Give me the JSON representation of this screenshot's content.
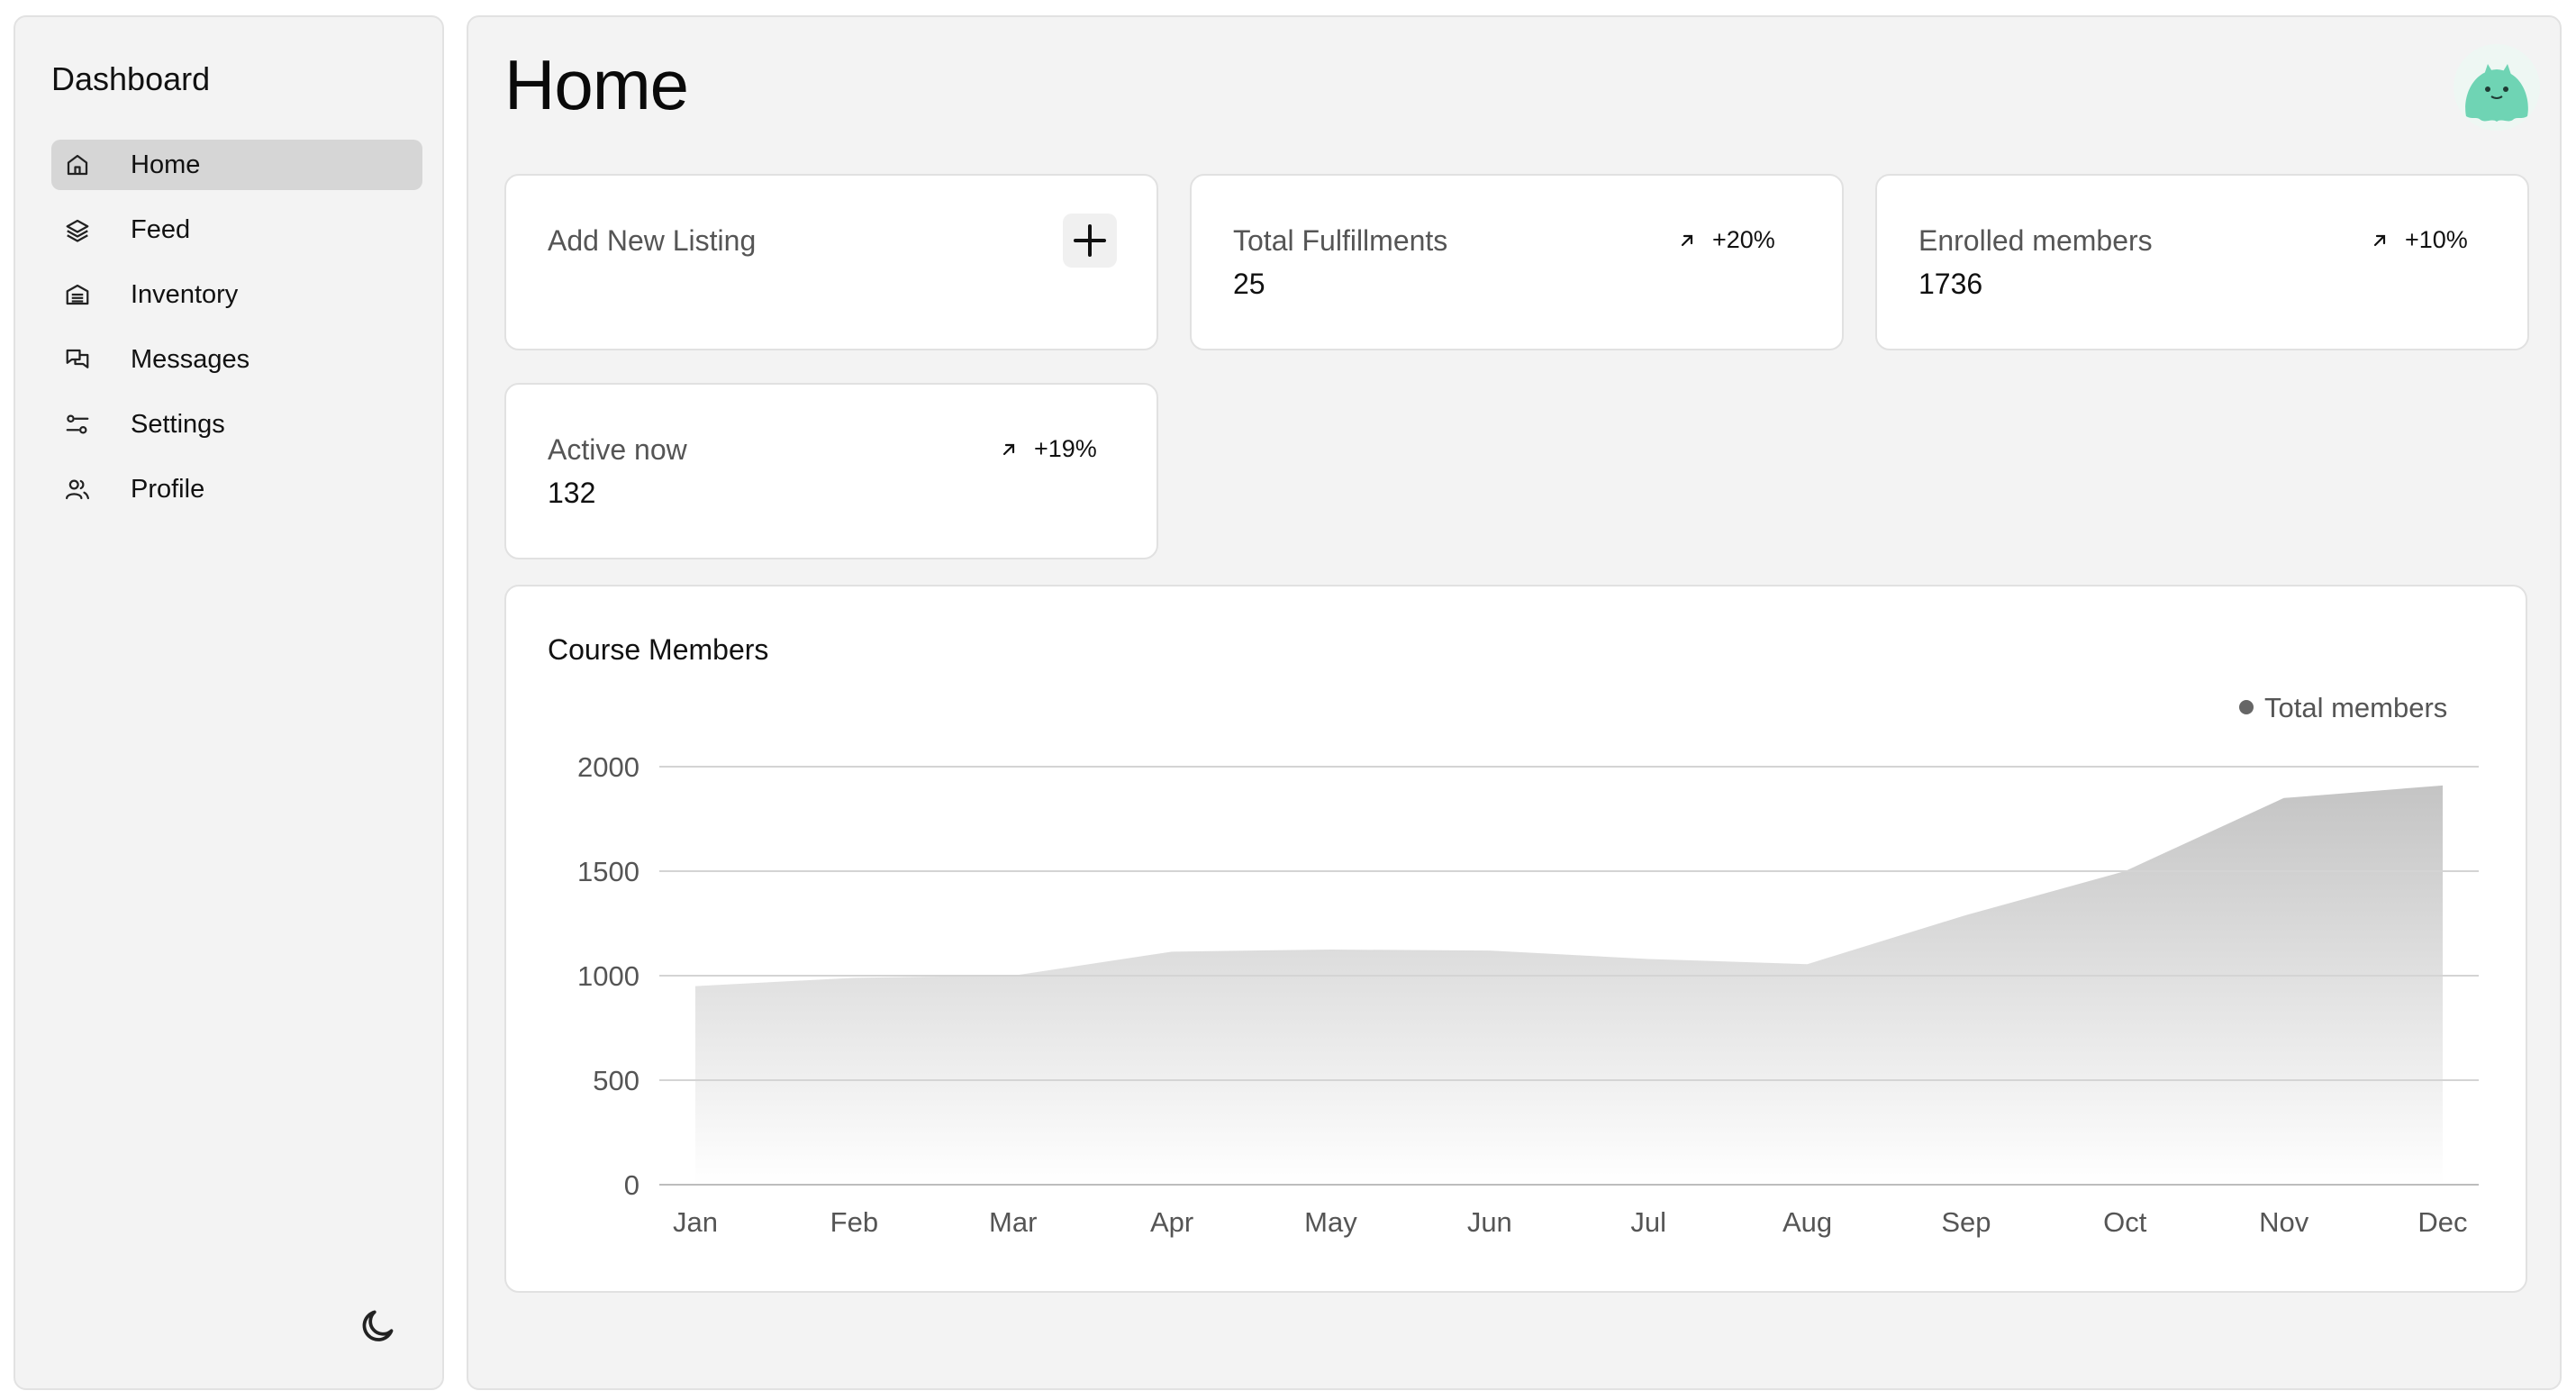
{
  "sidebar": {
    "title": "Dashboard",
    "items": [
      {
        "label": "Home",
        "icon": "home-icon",
        "active": true
      },
      {
        "label": "Feed",
        "icon": "layers-icon"
      },
      {
        "label": "Inventory",
        "icon": "inventory-icon"
      },
      {
        "label": "Messages",
        "icon": "messages-icon"
      },
      {
        "label": "Settings",
        "icon": "sliders-icon"
      },
      {
        "label": "Profile",
        "icon": "users-icon"
      }
    ],
    "theme_toggle_icon": "moon-icon"
  },
  "header": {
    "title": "Home",
    "avatar_icon": "mascot-avatar"
  },
  "cards": {
    "add_listing": {
      "label": "Add New Listing",
      "icon": "plus-icon"
    },
    "fulfillments": {
      "label": "Total Fulfillments",
      "value": "25",
      "trend": "+20%",
      "trend_icon": "arrow-up-right-icon"
    },
    "enrolled": {
      "label": "Enrolled members",
      "value": "1736",
      "trend": "+10%",
      "trend_icon": "arrow-up-right-icon"
    },
    "active": {
      "label": "Active now",
      "value": "132",
      "trend": "+19%",
      "trend_icon": "arrow-up-right-icon"
    }
  },
  "colors": {
    "accent_area": "#c4c4c4",
    "avatar": "#6fd4b4",
    "legend_dot": "#666666"
  },
  "chart_data": {
    "type": "area",
    "title": "Course Members",
    "categories": [
      "Jan",
      "Feb",
      "Mar",
      "Apr",
      "May",
      "Jun",
      "Jul",
      "Aug",
      "Sep",
      "Oct",
      "Nov",
      "Dec"
    ],
    "series": [
      {
        "name": "Total members",
        "values": [
          950,
          990,
          1000,
          1115,
          1125,
          1120,
          1080,
          1055,
          1290,
          1500,
          1850,
          1910
        ]
      }
    ],
    "yticks": [
      0,
      500,
      1000,
      1500,
      2000
    ],
    "ylim": [
      0,
      2000
    ],
    "grid": true,
    "legend": "top-right"
  }
}
